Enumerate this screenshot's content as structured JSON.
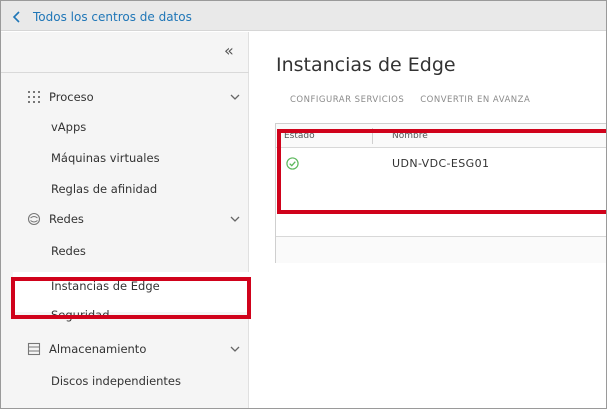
{
  "topbar": {
    "back_label": "Todos los centros de datos"
  },
  "sidebar": {
    "collapse_glyph": "«",
    "groups": {
      "proceso": {
        "label": "Proceso",
        "icon": "grid-icon"
      },
      "redes": {
        "label": "Redes",
        "icon": "network-icon"
      },
      "almacenamiento": {
        "label": "Almacenamiento",
        "icon": "storage-icon"
      }
    },
    "items": {
      "vapps": "vApps",
      "maquinas": "Máquinas virtuales",
      "reglas": "Reglas de afinidad",
      "redes": "Redes",
      "instancias": "Instancias de Edge",
      "seguridad": "Seguridad",
      "discos": "Discos independientes"
    }
  },
  "main": {
    "title": "Instancias de Edge",
    "actions": [
      "CONFIGURAR SERVICIOS",
      "CONVERTIR EN AVANZA"
    ],
    "grid": {
      "columns": [
        "Estado",
        "Nombre"
      ],
      "rows": [
        {
          "status": "ok",
          "name": "UDN-VDC-ESG01"
        }
      ]
    }
  },
  "colors": {
    "link": "#1f76b7",
    "highlight": "#d0021b",
    "ok": "#5cb85c"
  }
}
